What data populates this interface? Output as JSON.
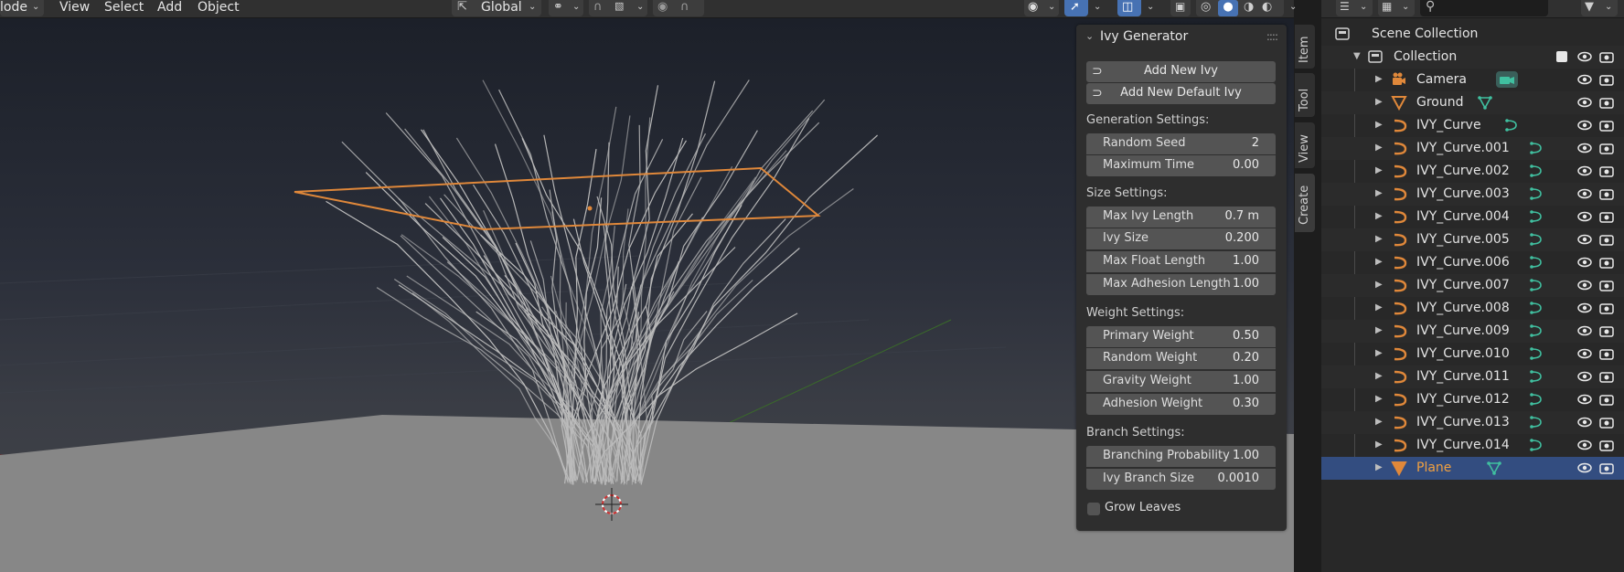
{
  "header": {
    "mode_label": "lode",
    "menus": [
      "View",
      "Select",
      "Add",
      "Object"
    ],
    "orientation_label": "Global"
  },
  "colors": {
    "accent_blue": "#4772b3",
    "selection_orange": "#f0a040",
    "curve_orange": "#e0883a",
    "data_green": "#40c0a0"
  },
  "panel": {
    "title": "Ivy Generator",
    "buttons": [
      {
        "label": "Add New Ivy",
        "icon": "curve-icon"
      },
      {
        "label": "Add New Default Ivy",
        "icon": "curve-path-icon"
      }
    ],
    "sections": {
      "generation": "Generation Settings:",
      "size": "Size Settings:",
      "weight": "Weight Settings:",
      "branch": "Branch Settings:"
    },
    "generation": [
      {
        "label": "Random Seed",
        "value": "2"
      },
      {
        "label": "Maximum Time",
        "value": "0.00"
      }
    ],
    "size": [
      {
        "label": "Max Ivy Length",
        "value": "0.7 m"
      },
      {
        "label": "Ivy Size",
        "value": "0.200"
      },
      {
        "label": "Max Float Length",
        "value": "1.00"
      },
      {
        "label": "Max Adhesion Length",
        "value": "1.00"
      }
    ],
    "weight": [
      {
        "label": "Primary Weight",
        "value": "0.50"
      },
      {
        "label": "Random Weight",
        "value": "0.20"
      },
      {
        "label": "Gravity Weight",
        "value": "1.00"
      },
      {
        "label": "Adhesion Weight",
        "value": "0.30"
      }
    ],
    "branch": [
      {
        "label": "Branching Probability",
        "value": "1.00"
      },
      {
        "label": "Ivy Branch Size",
        "value": "0.0010"
      }
    ],
    "grow_leaves_label": "Grow Leaves"
  },
  "tabs": [
    "Item",
    "Tool",
    "View",
    "Create"
  ],
  "outliner": {
    "scene_collection": "Scene Collection",
    "collection": "Collection",
    "objects": [
      {
        "name": "Camera",
        "type": "camera",
        "data_icon": "camera-data-icon"
      },
      {
        "name": "Ground",
        "type": "mesh",
        "data_icon": "mesh-data-icon"
      },
      {
        "name": "IVY_Curve",
        "type": "curve",
        "data_icon": "curve-data-icon"
      },
      {
        "name": "IVY_Curve.001",
        "type": "curve",
        "data_icon": "curve-data-icon"
      },
      {
        "name": "IVY_Curve.002",
        "type": "curve",
        "data_icon": "curve-data-icon"
      },
      {
        "name": "IVY_Curve.003",
        "type": "curve",
        "data_icon": "curve-data-icon"
      },
      {
        "name": "IVY_Curve.004",
        "type": "curve",
        "data_icon": "curve-data-icon"
      },
      {
        "name": "IVY_Curve.005",
        "type": "curve",
        "data_icon": "curve-data-icon"
      },
      {
        "name": "IVY_Curve.006",
        "type": "curve",
        "data_icon": "curve-data-icon"
      },
      {
        "name": "IVY_Curve.007",
        "type": "curve",
        "data_icon": "curve-data-icon"
      },
      {
        "name": "IVY_Curve.008",
        "type": "curve",
        "data_icon": "curve-data-icon"
      },
      {
        "name": "IVY_Curve.009",
        "type": "curve",
        "data_icon": "curve-data-icon"
      },
      {
        "name": "IVY_Curve.010",
        "type": "curve",
        "data_icon": "curve-data-icon"
      },
      {
        "name": "IVY_Curve.011",
        "type": "curve",
        "data_icon": "curve-data-icon"
      },
      {
        "name": "IVY_Curve.012",
        "type": "curve",
        "data_icon": "curve-data-icon"
      },
      {
        "name": "IVY_Curve.013",
        "type": "curve",
        "data_icon": "curve-data-icon"
      },
      {
        "name": "IVY_Curve.014",
        "type": "curve",
        "data_icon": "curve-data-icon"
      },
      {
        "name": "Plane",
        "type": "mesh",
        "data_icon": "mesh-data-icon",
        "selected": true
      }
    ]
  }
}
